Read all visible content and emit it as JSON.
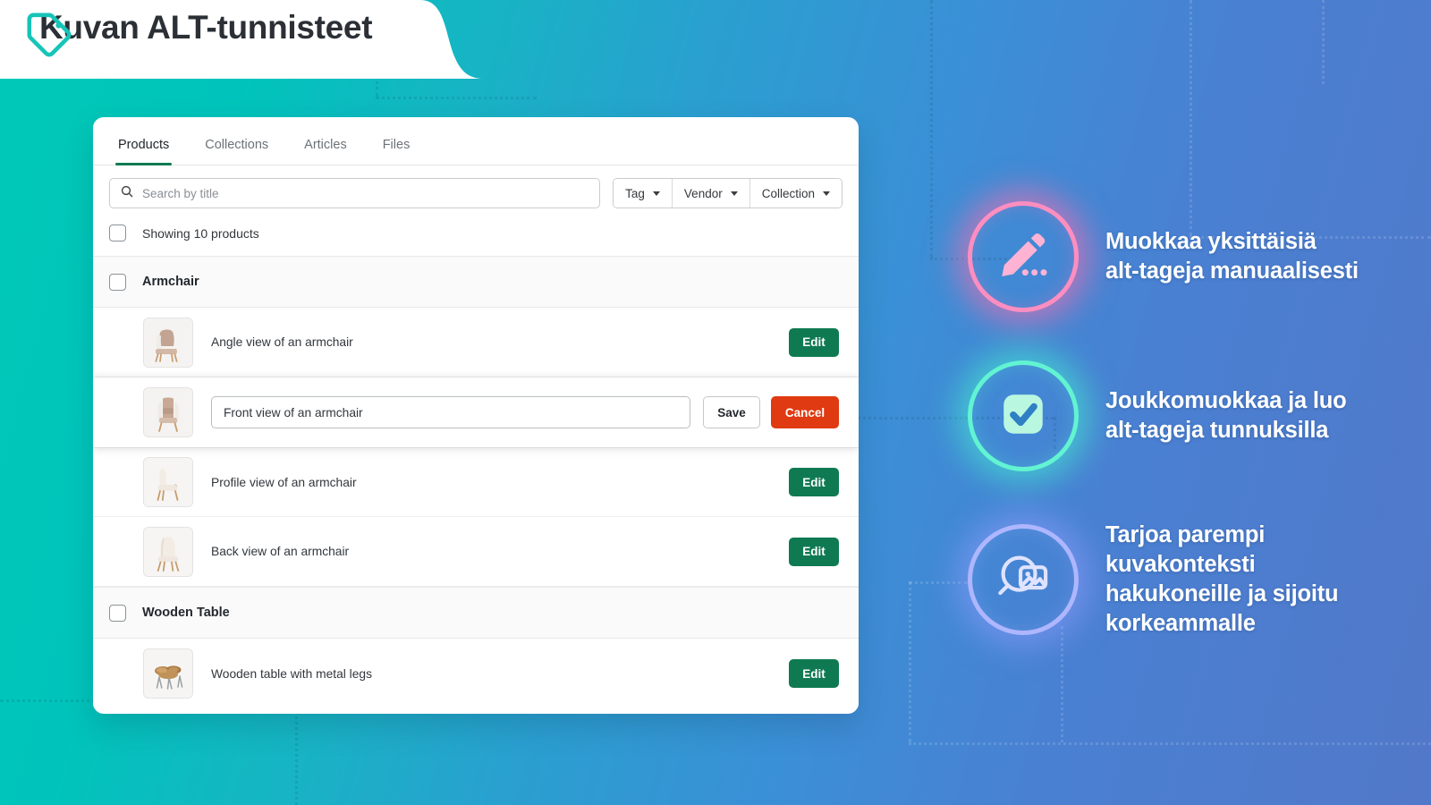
{
  "header": {
    "title": "Kuvan ALT-tunnisteet",
    "icon": "tag-icon",
    "accent_color": "#17c4b8"
  },
  "theme": {
    "background_gradient_from": "#00c9b7",
    "background_gradient_to": "#5278c9",
    "primary_button_color": "#0f7a52",
    "danger_button_color": "#e03a12",
    "active_tab_underline": "#0f7a52"
  },
  "card": {
    "tabs": [
      {
        "label": "Products",
        "active": true
      },
      {
        "label": "Collections",
        "active": false
      },
      {
        "label": "Articles",
        "active": false
      },
      {
        "label": "Files",
        "active": false
      }
    ],
    "search": {
      "placeholder": "Search by title",
      "value": "",
      "icon": "search-icon"
    },
    "filters": [
      {
        "label": "Tag",
        "icon": "chevron-down-icon"
      },
      {
        "label": "Vendor",
        "icon": "chevron-down-icon"
      },
      {
        "label": "Collection",
        "icon": "chevron-down-icon"
      }
    ],
    "showing_label": "Showing 10 products",
    "groups": [
      {
        "title": "Armchair",
        "items": [
          {
            "alt": "Angle view of an armchair",
            "thumb": "armchair-angle-thumb",
            "editing": false,
            "action": "Edit"
          },
          {
            "alt": "Front view of an armchair",
            "thumb": "armchair-front-thumb",
            "editing": true,
            "save": "Save",
            "cancel": "Cancel"
          },
          {
            "alt": "Profile view of an armchair",
            "thumb": "armchair-profile-thumb",
            "editing": false,
            "action": "Edit"
          },
          {
            "alt": "Back view of an armchair",
            "thumb": "armchair-back-thumb",
            "editing": false,
            "action": "Edit"
          }
        ]
      },
      {
        "title": "Wooden Table",
        "items": [
          {
            "alt": "Wooden table with metal legs",
            "thumb": "wooden-table-thumb",
            "editing": false,
            "action": "Edit"
          }
        ]
      }
    ]
  },
  "callouts": [
    {
      "id": "edit-manually",
      "icon": "pencil-dots-icon",
      "color": "#ff8ec0",
      "text": "Muokkaa yksittäisiä\nalt-tageja manuaalisesti"
    },
    {
      "id": "bulk-edit",
      "icon": "checkbox-check-icon",
      "color": "#62f4d2",
      "text": "Joukkomuokkaa ja luo\nalt-tageja tunnuksilla"
    },
    {
      "id": "seo-context",
      "icon": "image-search-icon",
      "color": "#aeb6ff",
      "text": "Tarjoa parempi\nkuvakonteksti\nhakukoneille ja sijoitu\nkorkeammalle"
    }
  ]
}
